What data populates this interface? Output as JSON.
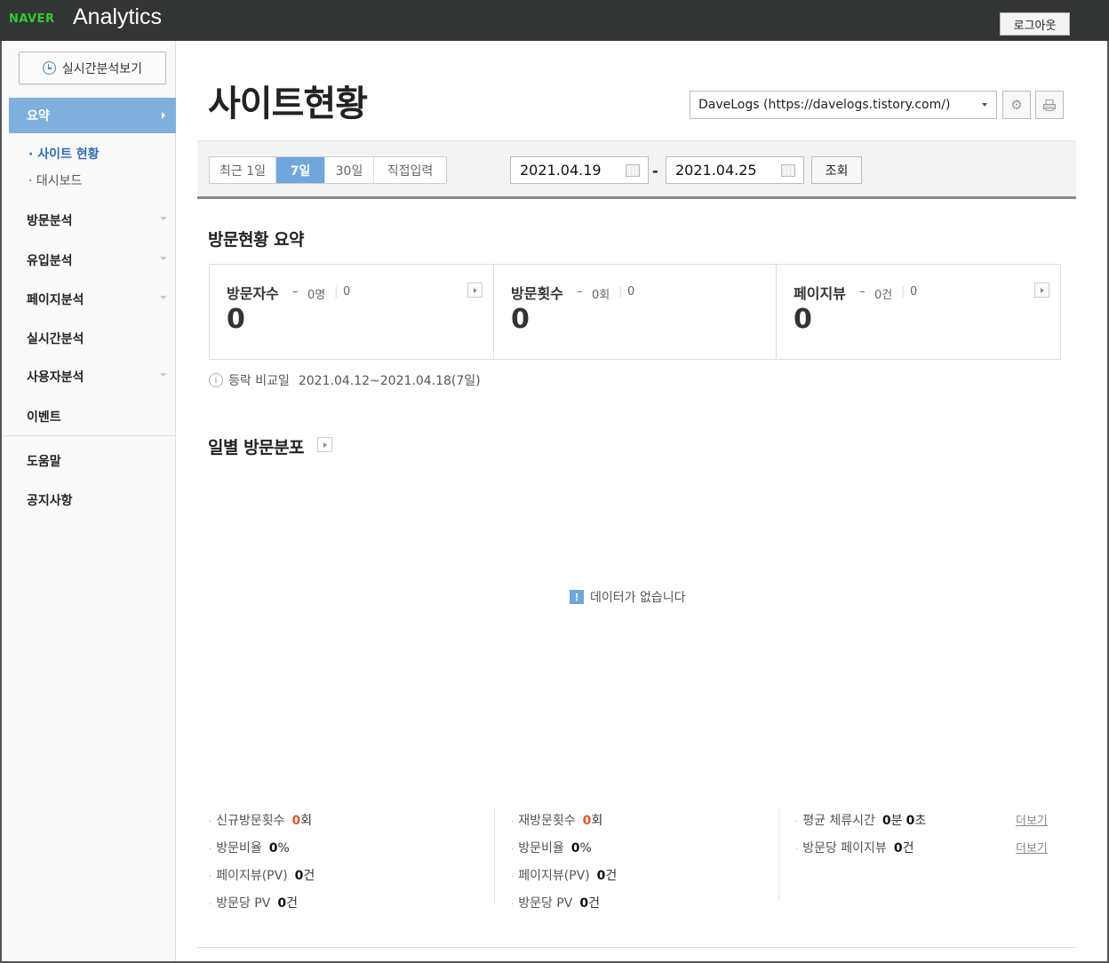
{
  "header": {
    "brand": "NAVER",
    "product": "Analytics",
    "logout_label": "로그아웃"
  },
  "sidebar": {
    "realtime_button": "실시간분석보기",
    "active_section": "요약",
    "sub_items": [
      "· 사이트 현황",
      "· 대시보드"
    ],
    "menu": [
      "방문분석",
      "유입분석",
      "페이지분석",
      "실시간분석",
      "사용자분석",
      "이벤트",
      "도움말",
      "공지사항"
    ]
  },
  "main": {
    "title": "사이트현황",
    "site_select": "DaveLogs (https://davelogs.tistory.com/)",
    "period_options": [
      "최근 1일",
      "7일",
      "30일",
      "직접입력"
    ],
    "selected_period": "7일",
    "date_from": "2021.04.19",
    "date_separator": "-",
    "date_to": "2021.04.25",
    "search_label": "조회",
    "summary_title": "방문현황 요약",
    "summary": [
      {
        "label": "방문자수",
        "dash": "–",
        "sub": "0명",
        "sub2": "0",
        "value": "0"
      },
      {
        "label": "방문횟수",
        "dash": "–",
        "sub": "0회",
        "sub2": "0",
        "value": "0"
      },
      {
        "label": "페이지뷰",
        "dash": "–",
        "sub": "0건",
        "sub2": "0",
        "value": "0"
      }
    ],
    "compare_label": "등락 비교일",
    "compare_range": "2021.04.12~2021.04.18(7일)",
    "daily_title": "일별 방문분포",
    "no_data": "데이터가 없습니다",
    "stats": {
      "col1": [
        {
          "label": "신규방문횟수",
          "value": "0",
          "unit": "회",
          "highlight": true
        },
        {
          "label": "방문비율",
          "value": "0",
          "unit": "%",
          "highlight": false
        },
        {
          "label": "페이지뷰(PV)",
          "value": "0",
          "unit": "건",
          "highlight": false
        },
        {
          "label": "방문당 PV",
          "value": "0",
          "unit": "건",
          "highlight": false
        }
      ],
      "col2": [
        {
          "label": "재방문횟수",
          "value": "0",
          "unit": "회",
          "highlight": true
        },
        {
          "label": "방문비율",
          "value": "0",
          "unit": "%",
          "highlight": false
        },
        {
          "label": "페이지뷰(PV)",
          "value": "0",
          "unit": "건",
          "highlight": false
        },
        {
          "label": "방문당 PV",
          "value": "0",
          "unit": "건",
          "highlight": false
        }
      ],
      "col3": [
        {
          "label": "평균 체류시간",
          "value": "0",
          "unit": "분",
          "value2": "0",
          "unit2": "초"
        },
        {
          "label": "방문당 페이지뷰",
          "value": "0",
          "unit": "건"
        }
      ],
      "more_label": "더보기"
    }
  },
  "colors": {
    "topbar": "#333535",
    "brand_green": "#2ecc2e",
    "active_nav": "#7fb0dd",
    "selected_period": "#6fa6dc",
    "highlight_value": "#e8542f"
  }
}
